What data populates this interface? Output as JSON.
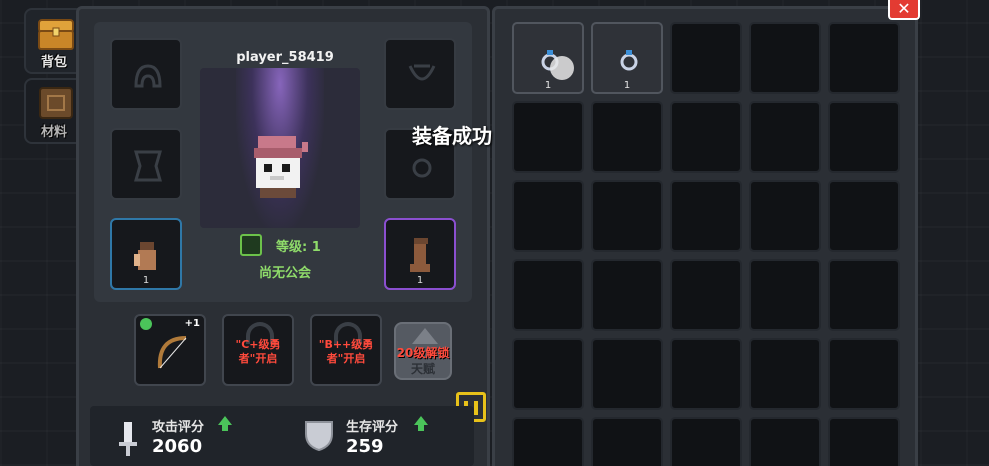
{
  "side_tabs": [
    {
      "label": "背包",
      "icon": "treasure-chest-icon",
      "active": true
    },
    {
      "label": "材料",
      "icon": "material-box-icon",
      "active": false
    }
  ],
  "player": {
    "name": "player_58419",
    "level_label": "等级: 1",
    "guild": "尚无公会"
  },
  "equipment_slots": {
    "helmet": {
      "icon": "helmet-icon"
    },
    "necklace": {
      "icon": "necklace-icon"
    },
    "armor": {
      "icon": "armor-icon"
    },
    "ring": {
      "icon": "ring-icon"
    },
    "gloves": {
      "icon": "glove-icon",
      "count": "1",
      "rarity": "blue"
    },
    "boots": {
      "icon": "boot-icon",
      "count": "1",
      "rarity": "purple"
    }
  },
  "bottom_slots": {
    "weapon": {
      "icon": "bow-icon",
      "plus": "+1"
    },
    "locked_c": {
      "message": "\"C+级勇者\"开启"
    },
    "locked_b": {
      "message": "\"B++级勇者\"开启"
    },
    "talent": {
      "level": "20级解锁",
      "name": "天赋"
    }
  },
  "scores": {
    "attack": {
      "label": "攻击评分",
      "value": "2060"
    },
    "survival": {
      "label": "生存评分",
      "value": "259"
    }
  },
  "inventory": {
    "items": [
      {
        "icon": "ring-icon",
        "count": "1"
      },
      {
        "icon": "ring-icon",
        "count": "1"
      }
    ],
    "total_cells": 30
  },
  "toast": "装备成功",
  "close_label": "✕",
  "colors": {
    "accent_green": "#8fdc6a",
    "rarity_blue": "#2f78a8",
    "rarity_purple": "#8b4fd0",
    "lock_red": "#ff4a3c",
    "close_red": "#e33b32"
  }
}
